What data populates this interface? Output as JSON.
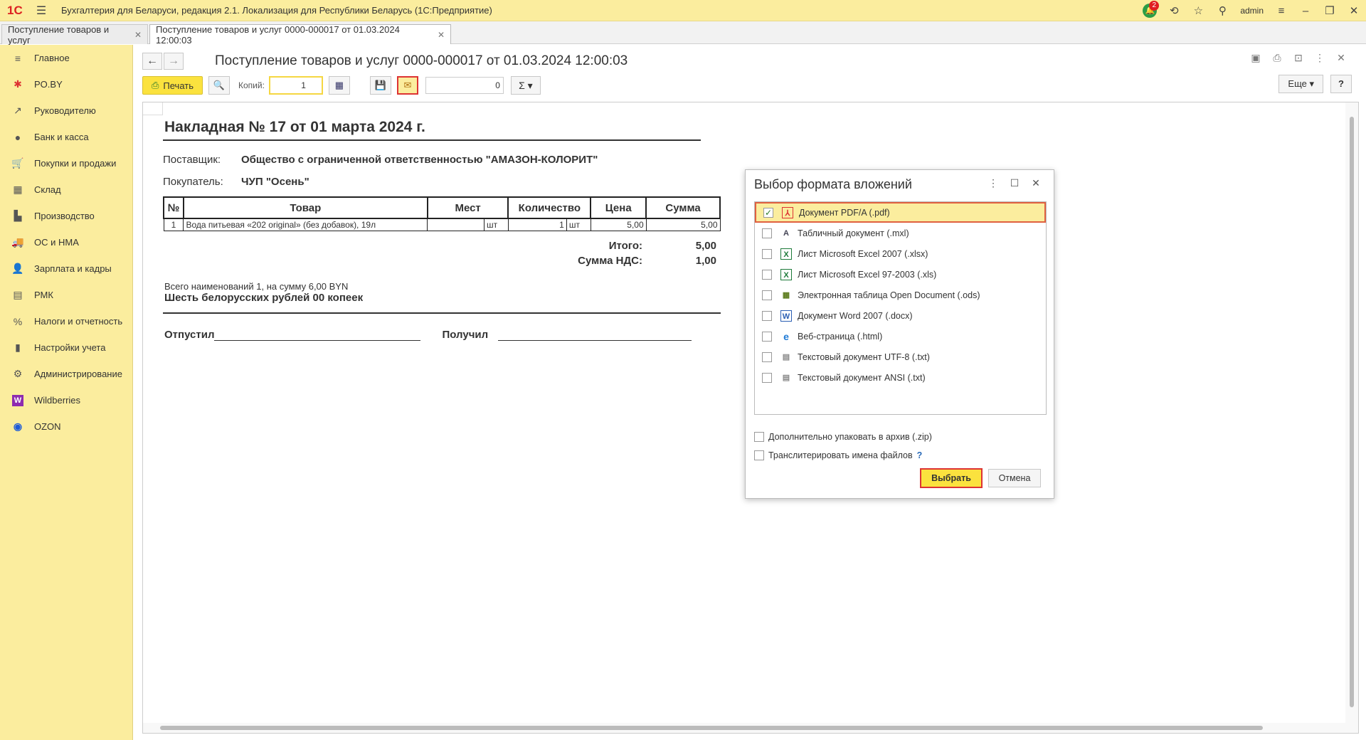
{
  "titlebar": {
    "logo": "1С",
    "app_title": "Бухгалтерия для Беларуси, редакция 2.1. Локализация для Республики Беларусь  (1С:Предприятие)",
    "notif_count": "2",
    "user": "admin"
  },
  "tabs": [
    {
      "label": "Поступление товаров и услуг"
    },
    {
      "label": "Поступление товаров и услуг 0000-000017 от 01.03.2024 12:00:03"
    }
  ],
  "sidebar": {
    "items": [
      {
        "label": "Главное",
        "icon": "menu-icon"
      },
      {
        "label": "PO.BY",
        "icon": "asterisk-icon"
      },
      {
        "label": "Руководителю",
        "icon": "chart-icon"
      },
      {
        "label": "Банк и касса",
        "icon": "coin-icon"
      },
      {
        "label": "Покупки и продажи",
        "icon": "cart-icon"
      },
      {
        "label": "Склад",
        "icon": "grid-icon"
      },
      {
        "label": "Производство",
        "icon": "factory-icon"
      },
      {
        "label": "ОС и НМА",
        "icon": "truck-icon"
      },
      {
        "label": "Зарплата и кадры",
        "icon": "person-icon"
      },
      {
        "label": "РМК",
        "icon": "register-icon"
      },
      {
        "label": "Налоги и отчетность",
        "icon": "tax-icon"
      },
      {
        "label": "Настройки учета",
        "icon": "book-icon"
      },
      {
        "label": "Администрирование",
        "icon": "gear-icon"
      },
      {
        "label": "Wildberries",
        "icon": "wildberries-icon"
      },
      {
        "label": "OZON",
        "icon": "ozon-icon"
      }
    ]
  },
  "doc": {
    "title": "Поступление товаров и услуг 0000-000017 от 01.03.2024 12:00:03",
    "print_label": "Печать",
    "copies_label": "Копий:",
    "copies_value": "1",
    "sum_value": "0",
    "more_label": "Еще",
    "help_label": "?"
  },
  "invoice": {
    "title": "Накладная № 17 от 01 марта 2024 г.",
    "supplier_label": "Поставщик:",
    "supplier": "Общество с ограниченной ответственностью \"АМАЗОН-КОЛОРИТ\"",
    "buyer_label": "Покупатель:",
    "buyer": "ЧУП \"Осень\"",
    "headers": [
      "№",
      "Товар",
      "Мест",
      "Количество",
      "Цена",
      "Сумма"
    ],
    "rows": [
      {
        "n": "1",
        "item": "Вода питьевая «202 original» (без добавок), 19л",
        "places": "",
        "places_unit": "шт",
        "qty": "1",
        "qty_unit": "шт",
        "price": "5,00",
        "sum": "5,00"
      }
    ],
    "total_label": "Итого:",
    "total": "5,00",
    "vat_label": "Сумма НДС:",
    "vat": "1,00",
    "words_line1": "Всего наименований 1, на сумму 6,00 BYN",
    "words_line2": "Шесть белорусских рублей 00 копеек",
    "released_label": "Отпустил",
    "received_label": "Получил"
  },
  "dialog": {
    "title": "Выбор формата вложений",
    "formats": [
      {
        "label": "Документ PDF/A (.pdf)",
        "checked": true,
        "icon": "pdf-icon"
      },
      {
        "label": "Табличный документ (.mxl)",
        "checked": false,
        "icon": "mxl-icon"
      },
      {
        "label": "Лист Microsoft Excel 2007 (.xlsx)",
        "checked": false,
        "icon": "excel-icon"
      },
      {
        "label": "Лист Microsoft Excel 97-2003 (.xls)",
        "checked": false,
        "icon": "excel-icon"
      },
      {
        "label": "Электронная таблица Open Document (.ods)",
        "checked": false,
        "icon": "ods-icon"
      },
      {
        "label": "Документ Word 2007 (.docx)",
        "checked": false,
        "icon": "word-icon"
      },
      {
        "label": "Веб-страница (.html)",
        "checked": false,
        "icon": "html-icon"
      },
      {
        "label": "Текстовый документ UTF-8 (.txt)",
        "checked": false,
        "icon": "txt-icon"
      },
      {
        "label": "Текстовый документ ANSI (.txt)",
        "checked": false,
        "icon": "txt-icon"
      }
    ],
    "zip_label": "Дополнительно упаковать в архив (.zip)",
    "translit_label": "Транслитерировать имена файлов",
    "help": "?",
    "select_label": "Выбрать",
    "cancel_label": "Отмена"
  },
  "colors": {
    "sidebar_bg": "#fbed9e",
    "accent_yellow": "#fbe23e",
    "highlight_red": "#dd3333"
  }
}
